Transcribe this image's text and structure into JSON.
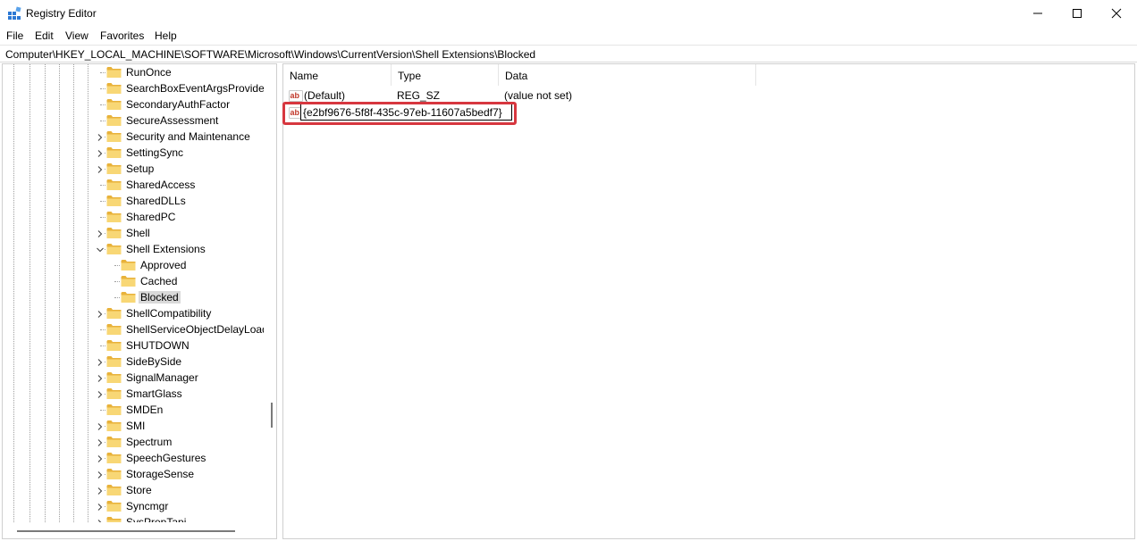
{
  "window": {
    "title": "Registry Editor"
  },
  "menu": [
    "File",
    "Edit",
    "View",
    "Favorites",
    "Help"
  ],
  "address": "Computer\\HKEY_LOCAL_MACHINE\\SOFTWARE\\Microsoft\\Windows\\CurrentVersion\\Shell Extensions\\Blocked",
  "tree": [
    {
      "label": "RunOnce",
      "depth": 0,
      "expand": "none"
    },
    {
      "label": "SearchBoxEventArgsProvider",
      "depth": 0,
      "expand": "none"
    },
    {
      "label": "SecondaryAuthFactor",
      "depth": 0,
      "expand": "none"
    },
    {
      "label": "SecureAssessment",
      "depth": 0,
      "expand": "none"
    },
    {
      "label": "Security and Maintenance",
      "depth": 0,
      "expand": "collapsed"
    },
    {
      "label": "SettingSync",
      "depth": 0,
      "expand": "collapsed"
    },
    {
      "label": "Setup",
      "depth": 0,
      "expand": "collapsed"
    },
    {
      "label": "SharedAccess",
      "depth": 0,
      "expand": "none"
    },
    {
      "label": "SharedDLLs",
      "depth": 0,
      "expand": "none"
    },
    {
      "label": "SharedPC",
      "depth": 0,
      "expand": "none"
    },
    {
      "label": "Shell",
      "depth": 0,
      "expand": "collapsed"
    },
    {
      "label": "Shell Extensions",
      "depth": 0,
      "expand": "expanded"
    },
    {
      "label": "Approved",
      "depth": 1,
      "expand": "none"
    },
    {
      "label": "Cached",
      "depth": 1,
      "expand": "none"
    },
    {
      "label": "Blocked",
      "depth": 1,
      "expand": "none",
      "selected": true
    },
    {
      "label": "ShellCompatibility",
      "depth": 0,
      "expand": "collapsed"
    },
    {
      "label": "ShellServiceObjectDelayLoad",
      "depth": 0,
      "expand": "none"
    },
    {
      "label": "SHUTDOWN",
      "depth": 0,
      "expand": "none"
    },
    {
      "label": "SideBySide",
      "depth": 0,
      "expand": "collapsed"
    },
    {
      "label": "SignalManager",
      "depth": 0,
      "expand": "collapsed"
    },
    {
      "label": "SmartGlass",
      "depth": 0,
      "expand": "collapsed"
    },
    {
      "label": "SMDEn",
      "depth": 0,
      "expand": "none"
    },
    {
      "label": "SMI",
      "depth": 0,
      "expand": "collapsed"
    },
    {
      "label": "Spectrum",
      "depth": 0,
      "expand": "collapsed"
    },
    {
      "label": "SpeechGestures",
      "depth": 0,
      "expand": "collapsed"
    },
    {
      "label": "StorageSense",
      "depth": 0,
      "expand": "collapsed"
    },
    {
      "label": "Store",
      "depth": 0,
      "expand": "collapsed"
    },
    {
      "label": "Syncmgr",
      "depth": 0,
      "expand": "collapsed"
    },
    {
      "label": "SysPrepTapi",
      "depth": 0,
      "expand": "collapsed"
    }
  ],
  "values": {
    "columns": {
      "name": "Name",
      "type": "Type",
      "data": "Data"
    },
    "rows": [
      {
        "name": "(Default)",
        "type": "REG_SZ",
        "data": "(value not set)"
      }
    ],
    "editing": {
      "value": "{e2bf9676-5f8f-435c-97eb-11607a5bedf7}"
    }
  },
  "colors": {
    "highlight": "#d7373f",
    "folder": "#f8d775",
    "folder_dark": "#e8b23a",
    "selection": "#d9d9d9"
  },
  "icons": {
    "app": "registry-editor-icon",
    "tree_item": "folder-icon",
    "value": "string-value-ab-icon",
    "window": [
      "minimize-icon",
      "maximize-icon",
      "close-icon"
    ]
  }
}
